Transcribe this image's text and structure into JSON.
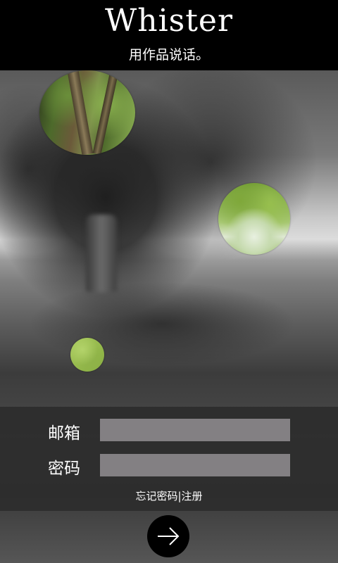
{
  "header": {
    "title": "Whister",
    "slogan": "用作品说话。"
  },
  "login": {
    "email_label": "邮箱",
    "password_label": "密码",
    "email_value": "",
    "password_value": "",
    "forgot_label": "忘记密码",
    "separator": "|",
    "register_label": "注册"
  },
  "icons": {
    "submit": "arrow-right-icon"
  },
  "colors": {
    "header_bg": "#000000",
    "input_bg": "#838083",
    "panel_bg": "#2d2d2d"
  }
}
